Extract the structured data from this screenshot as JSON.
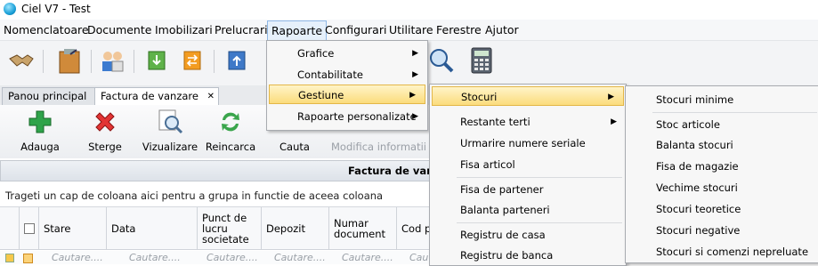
{
  "window": {
    "title": "Ciel V7 - Test"
  },
  "menubar": [
    "Nomenclatoare",
    "Documente",
    "Imobilizari",
    "Prelucrari",
    "Rapoarte",
    "Configurari",
    "Utilitare",
    "Ferestre",
    "Ajutor"
  ],
  "tabs": {
    "home": "Panou principal",
    "doc": "Factura de vanzare",
    "close": "✕"
  },
  "ribbon": {
    "add": "Adauga",
    "delete": "Sterge",
    "view": "Vizualizare",
    "reload": "Reincarca",
    "search": "Cauta",
    "modify": "Modifica informatii"
  },
  "grid": {
    "title": "Factura de vanzare",
    "group_hint": "Trageti un cap de coloana aici pentru a grupa in functie de aceea coloana",
    "columns": [
      "Stare",
      "Data",
      "Punct de lucru societate",
      "Depozit",
      "Numar document",
      "Cod pa"
    ],
    "filter": [
      "Cautare....",
      "Cautare....",
      "Cautare....",
      "Cautare....",
      "Cautare....",
      "Cau"
    ]
  },
  "menu_rapoarte": [
    "Grafice",
    "Contabilitate",
    "Gestiune",
    "Rapoarte personalizate"
  ],
  "menu_gestiune": [
    "Stocuri",
    "Restante terti",
    "Urmarire numere seriale",
    "Fisa articol",
    "Fisa de partener",
    "Balanta parteneri",
    "Registru de casa",
    "Registru de banca"
  ],
  "menu_stocuri": [
    "Stocuri minime",
    "Stoc articole",
    "Balanta stocuri",
    "Fisa de magazie",
    "Vechime stocuri",
    "Stocuri teoretice",
    "Stocuri negative",
    "Stocuri si comenzi nepreluate"
  ],
  "colors": {
    "highlight": "#fbdc7c",
    "menu_bg": "#f7f7f7"
  }
}
